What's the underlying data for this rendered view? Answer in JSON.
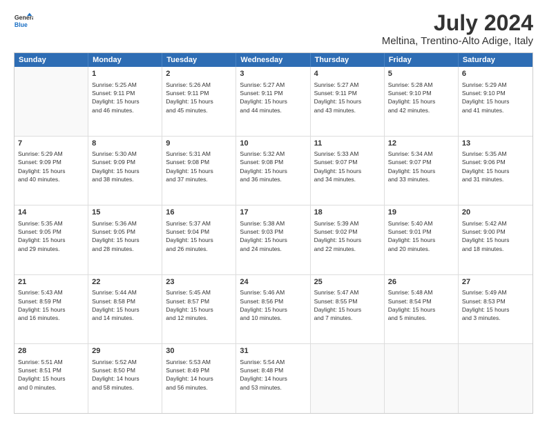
{
  "logo": {
    "line1": "General",
    "line2": "Blue"
  },
  "title": "July 2024",
  "subtitle": "Meltina, Trentino-Alto Adige, Italy",
  "header": {
    "days": [
      "Sunday",
      "Monday",
      "Tuesday",
      "Wednesday",
      "Thursday",
      "Friday",
      "Saturday"
    ]
  },
  "rows": [
    [
      {
        "day": "",
        "lines": []
      },
      {
        "day": "1",
        "lines": [
          "Sunrise: 5:25 AM",
          "Sunset: 9:11 PM",
          "Daylight: 15 hours",
          "and 46 minutes."
        ]
      },
      {
        "day": "2",
        "lines": [
          "Sunrise: 5:26 AM",
          "Sunset: 9:11 PM",
          "Daylight: 15 hours",
          "and 45 minutes."
        ]
      },
      {
        "day": "3",
        "lines": [
          "Sunrise: 5:27 AM",
          "Sunset: 9:11 PM",
          "Daylight: 15 hours",
          "and 44 minutes."
        ]
      },
      {
        "day": "4",
        "lines": [
          "Sunrise: 5:27 AM",
          "Sunset: 9:11 PM",
          "Daylight: 15 hours",
          "and 43 minutes."
        ]
      },
      {
        "day": "5",
        "lines": [
          "Sunrise: 5:28 AM",
          "Sunset: 9:10 PM",
          "Daylight: 15 hours",
          "and 42 minutes."
        ]
      },
      {
        "day": "6",
        "lines": [
          "Sunrise: 5:29 AM",
          "Sunset: 9:10 PM",
          "Daylight: 15 hours",
          "and 41 minutes."
        ]
      }
    ],
    [
      {
        "day": "7",
        "lines": [
          "Sunrise: 5:29 AM",
          "Sunset: 9:09 PM",
          "Daylight: 15 hours",
          "and 40 minutes."
        ]
      },
      {
        "day": "8",
        "lines": [
          "Sunrise: 5:30 AM",
          "Sunset: 9:09 PM",
          "Daylight: 15 hours",
          "and 38 minutes."
        ]
      },
      {
        "day": "9",
        "lines": [
          "Sunrise: 5:31 AM",
          "Sunset: 9:08 PM",
          "Daylight: 15 hours",
          "and 37 minutes."
        ]
      },
      {
        "day": "10",
        "lines": [
          "Sunrise: 5:32 AM",
          "Sunset: 9:08 PM",
          "Daylight: 15 hours",
          "and 36 minutes."
        ]
      },
      {
        "day": "11",
        "lines": [
          "Sunrise: 5:33 AM",
          "Sunset: 9:07 PM",
          "Daylight: 15 hours",
          "and 34 minutes."
        ]
      },
      {
        "day": "12",
        "lines": [
          "Sunrise: 5:34 AM",
          "Sunset: 9:07 PM",
          "Daylight: 15 hours",
          "and 33 minutes."
        ]
      },
      {
        "day": "13",
        "lines": [
          "Sunrise: 5:35 AM",
          "Sunset: 9:06 PM",
          "Daylight: 15 hours",
          "and 31 minutes."
        ]
      }
    ],
    [
      {
        "day": "14",
        "lines": [
          "Sunrise: 5:35 AM",
          "Sunset: 9:05 PM",
          "Daylight: 15 hours",
          "and 29 minutes."
        ]
      },
      {
        "day": "15",
        "lines": [
          "Sunrise: 5:36 AM",
          "Sunset: 9:05 PM",
          "Daylight: 15 hours",
          "and 28 minutes."
        ]
      },
      {
        "day": "16",
        "lines": [
          "Sunrise: 5:37 AM",
          "Sunset: 9:04 PM",
          "Daylight: 15 hours",
          "and 26 minutes."
        ]
      },
      {
        "day": "17",
        "lines": [
          "Sunrise: 5:38 AM",
          "Sunset: 9:03 PM",
          "Daylight: 15 hours",
          "and 24 minutes."
        ]
      },
      {
        "day": "18",
        "lines": [
          "Sunrise: 5:39 AM",
          "Sunset: 9:02 PM",
          "Daylight: 15 hours",
          "and 22 minutes."
        ]
      },
      {
        "day": "19",
        "lines": [
          "Sunrise: 5:40 AM",
          "Sunset: 9:01 PM",
          "Daylight: 15 hours",
          "and 20 minutes."
        ]
      },
      {
        "day": "20",
        "lines": [
          "Sunrise: 5:42 AM",
          "Sunset: 9:00 PM",
          "Daylight: 15 hours",
          "and 18 minutes."
        ]
      }
    ],
    [
      {
        "day": "21",
        "lines": [
          "Sunrise: 5:43 AM",
          "Sunset: 8:59 PM",
          "Daylight: 15 hours",
          "and 16 minutes."
        ]
      },
      {
        "day": "22",
        "lines": [
          "Sunrise: 5:44 AM",
          "Sunset: 8:58 PM",
          "Daylight: 15 hours",
          "and 14 minutes."
        ]
      },
      {
        "day": "23",
        "lines": [
          "Sunrise: 5:45 AM",
          "Sunset: 8:57 PM",
          "Daylight: 15 hours",
          "and 12 minutes."
        ]
      },
      {
        "day": "24",
        "lines": [
          "Sunrise: 5:46 AM",
          "Sunset: 8:56 PM",
          "Daylight: 15 hours",
          "and 10 minutes."
        ]
      },
      {
        "day": "25",
        "lines": [
          "Sunrise: 5:47 AM",
          "Sunset: 8:55 PM",
          "Daylight: 15 hours",
          "and 7 minutes."
        ]
      },
      {
        "day": "26",
        "lines": [
          "Sunrise: 5:48 AM",
          "Sunset: 8:54 PM",
          "Daylight: 15 hours",
          "and 5 minutes."
        ]
      },
      {
        "day": "27",
        "lines": [
          "Sunrise: 5:49 AM",
          "Sunset: 8:53 PM",
          "Daylight: 15 hours",
          "and 3 minutes."
        ]
      }
    ],
    [
      {
        "day": "28",
        "lines": [
          "Sunrise: 5:51 AM",
          "Sunset: 8:51 PM",
          "Daylight: 15 hours",
          "and 0 minutes."
        ]
      },
      {
        "day": "29",
        "lines": [
          "Sunrise: 5:52 AM",
          "Sunset: 8:50 PM",
          "Daylight: 14 hours",
          "and 58 minutes."
        ]
      },
      {
        "day": "30",
        "lines": [
          "Sunrise: 5:53 AM",
          "Sunset: 8:49 PM",
          "Daylight: 14 hours",
          "and 56 minutes."
        ]
      },
      {
        "day": "31",
        "lines": [
          "Sunrise: 5:54 AM",
          "Sunset: 8:48 PM",
          "Daylight: 14 hours",
          "and 53 minutes."
        ]
      },
      {
        "day": "",
        "lines": []
      },
      {
        "day": "",
        "lines": []
      },
      {
        "day": "",
        "lines": []
      }
    ]
  ]
}
